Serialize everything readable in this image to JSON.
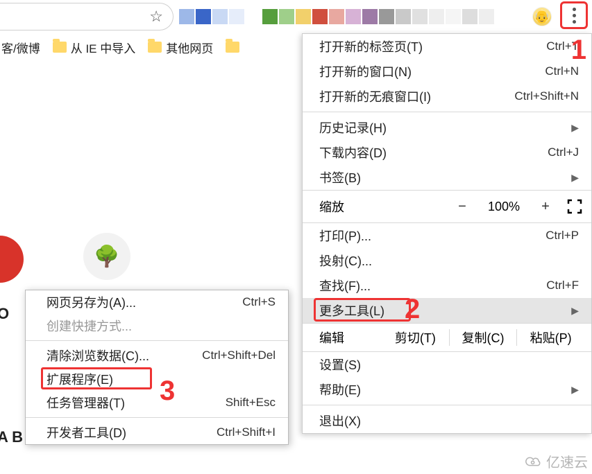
{
  "toolbar": {
    "star": "☆",
    "avatar_emoji": "👴"
  },
  "bookmarks": {
    "items": [
      {
        "label": "客/微博"
      },
      {
        "label": "从 IE 中导入"
      },
      {
        "label": "其他网页"
      },
      {
        "label": ""
      }
    ]
  },
  "main_menu": {
    "section1": [
      {
        "label": "打开新的标签页(T)",
        "shortcut": "Ctrl+T"
      },
      {
        "label": "打开新的窗口(N)",
        "shortcut": "Ctrl+N"
      },
      {
        "label": "打开新的无痕窗口(I)",
        "shortcut": "Ctrl+Shift+N"
      }
    ],
    "section2": [
      {
        "label": "历史记录(H)",
        "sub": true
      },
      {
        "label": "下载内容(D)",
        "shortcut": "Ctrl+J"
      },
      {
        "label": "书签(B)",
        "sub": true
      }
    ],
    "zoom": {
      "label": "缩放",
      "minus": "−",
      "value": "100%",
      "plus": "+"
    },
    "section3": [
      {
        "label": "打印(P)...",
        "shortcut": "Ctrl+P"
      },
      {
        "label": "投射(C)..."
      },
      {
        "label": "查找(F)...",
        "shortcut": "Ctrl+F"
      },
      {
        "label": "更多工具(L)",
        "sub": true,
        "highlighted": true
      }
    ],
    "edit": {
      "label": "编辑",
      "cut": "剪切(T)",
      "copy": "复制(C)",
      "paste": "粘贴(P)"
    },
    "section4": [
      {
        "label": "设置(S)"
      },
      {
        "label": "帮助(E)",
        "sub": true
      }
    ],
    "section5": [
      {
        "label": "退出(X)"
      }
    ]
  },
  "submenu": {
    "items": [
      {
        "label": "网页另存为(A)...",
        "shortcut": "Ctrl+S"
      },
      {
        "label": "创建快捷方式...",
        "disabled": true
      },
      {
        "sep": true
      },
      {
        "label": "清除浏览数据(C)...",
        "shortcut": "Ctrl+Shift+Del"
      },
      {
        "label": "扩展程序(E)",
        "boxed": true
      },
      {
        "label": "任务管理器(T)",
        "shortcut": "Shift+Esc"
      },
      {
        "sep": true
      },
      {
        "label": "开发者工具(D)",
        "shortcut": "Ctrl+Shift+I"
      }
    ]
  },
  "annotations": {
    "n1": "1",
    "n2": "2",
    "n3": "3"
  },
  "page_fragments": {
    "to": "O",
    "ab": "A B"
  },
  "watermark": "亿速云",
  "swatches": [
    "#9db8e8",
    "#3a66c8",
    "#c9d9f4",
    "#e6edfa",
    "#fff",
    "#569e3d",
    "#9fcf8a",
    "#f2d06b",
    "#d04f3e",
    "#e8a8a0",
    "#d7b2d6",
    "#9d7aa6",
    "#999",
    "#c9c9c9",
    "#e0e0e0",
    "#eee",
    "#f5f5f5",
    "#ddd",
    "#eee",
    "#fff"
  ]
}
